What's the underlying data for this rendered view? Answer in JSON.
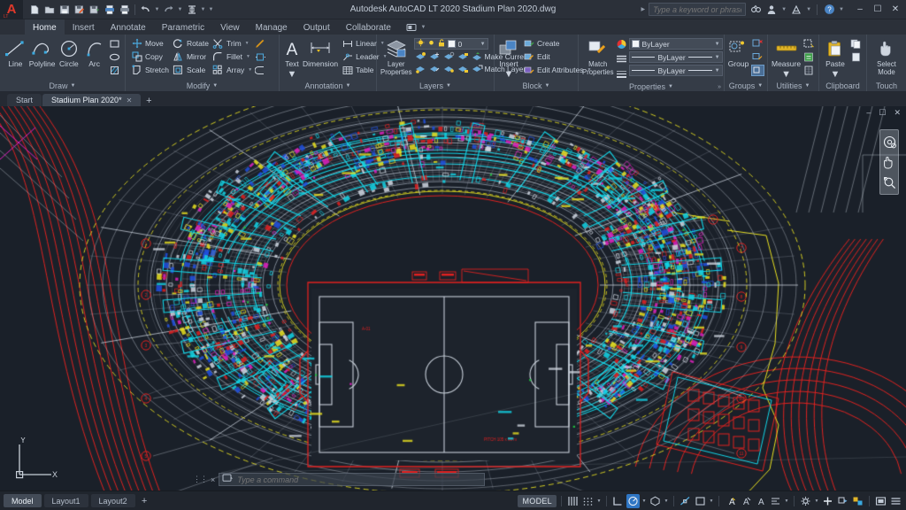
{
  "titlebar": {
    "app_logo": "autodesk-a",
    "title": "Autodesk AutoCAD LT 2020    Stadium Plan 2020.dwg",
    "search_placeholder": "Type a keyword or phrase",
    "quick_access": [
      {
        "name": "new-file",
        "icon": "page"
      },
      {
        "name": "open-file",
        "icon": "folder"
      },
      {
        "name": "save-file",
        "icon": "floppy"
      },
      {
        "name": "save-as",
        "icon": "floppy-pencil"
      },
      {
        "name": "plot-preview",
        "icon": "floppy-arrow"
      },
      {
        "name": "plot",
        "icon": "printer-blue"
      },
      {
        "name": "print",
        "icon": "printer"
      },
      {
        "name": "undo",
        "icon": "undo-arrow"
      },
      {
        "name": "redo",
        "icon": "redo-arrow"
      },
      {
        "name": "match-layer",
        "icon": "column"
      }
    ],
    "window_buttons": [
      "minimize",
      "restore",
      "close"
    ]
  },
  "ribbon_tabs": [
    {
      "label": "Home",
      "active": true
    },
    {
      "label": "Insert",
      "active": false
    },
    {
      "label": "Annotate",
      "active": false
    },
    {
      "label": "Parametric",
      "active": false
    },
    {
      "label": "View",
      "active": false
    },
    {
      "label": "Manage",
      "active": false
    },
    {
      "label": "Output",
      "active": false
    },
    {
      "label": "Collaborate",
      "active": false
    }
  ],
  "ribbon": {
    "draw": {
      "title": "Draw",
      "buttons": [
        {
          "label": "Line",
          "icon": "line-icon"
        },
        {
          "label": "Polyline",
          "icon": "polyline-icon"
        },
        {
          "label": "Circle",
          "icon": "circle-icon"
        },
        {
          "label": "Arc",
          "icon": "arc-icon"
        }
      ],
      "extras": [
        "rectangle-icon",
        "ellipse-icon",
        "hatch-icon"
      ]
    },
    "modify": {
      "title": "Modify",
      "col1": [
        {
          "label": "Move",
          "icon": "move-icon"
        },
        {
          "label": "Copy",
          "icon": "copy-icon"
        },
        {
          "label": "Stretch",
          "icon": "stretch-icon"
        }
      ],
      "col2": [
        {
          "label": "Rotate",
          "icon": "rotate-icon"
        },
        {
          "label": "Mirror",
          "icon": "mirror-icon"
        },
        {
          "label": "Scale",
          "icon": "scale-icon"
        }
      ],
      "col3": [
        {
          "label": "Trim",
          "icon": "trim-icon"
        },
        {
          "label": "Fillet",
          "icon": "fillet-icon"
        },
        {
          "label": "Array",
          "icon": "array-icon"
        }
      ],
      "extras": [
        "explode-icon",
        "offset-icon",
        "erase-icon"
      ]
    },
    "annotation": {
      "title": "Annotation",
      "buttons": [
        {
          "label": "Text",
          "icon": "text-icon"
        },
        {
          "label": "Dimension",
          "icon": "dimension-icon"
        }
      ],
      "list": [
        {
          "label": "Linear",
          "icon": "linear-dim-icon"
        },
        {
          "label": "Leader",
          "icon": "leader-icon"
        },
        {
          "label": "Table",
          "icon": "table-icon"
        }
      ]
    },
    "layers": {
      "title": "Layers",
      "big_button": {
        "label": "Layer Properties",
        "icon": "layers-icon"
      },
      "current_layer": "0",
      "actions": [
        {
          "label": "Make Current",
          "icon": "make-current-icon"
        },
        {
          "label": "Match Layer",
          "icon": "match-layer-icon"
        }
      ]
    },
    "block": {
      "title": "Block",
      "big_button": {
        "label": "Insert",
        "icon": "insert-block-icon"
      },
      "items": [
        {
          "label": "Create",
          "icon": "create-block-icon"
        },
        {
          "label": "Edit",
          "icon": "edit-block-icon"
        },
        {
          "label": "Edit Attributes",
          "icon": "edit-attributes-icon"
        }
      ]
    },
    "properties": {
      "title": "Properties",
      "big_button": {
        "label": "Match Properties",
        "icon": "match-properties-icon"
      },
      "color": "ByLayer",
      "linetype": "ByLayer",
      "lineweight": "ByLayer"
    },
    "groups": {
      "title": "Groups",
      "big_button": {
        "label": "Group",
        "icon": "group-icon"
      }
    },
    "utilities": {
      "title": "Utilities",
      "big_button": {
        "label": "Measure",
        "icon": "measure-icon"
      }
    },
    "clipboard": {
      "title": "Clipboard",
      "big_button": {
        "label": "Paste",
        "icon": "paste-icon"
      }
    },
    "touch": {
      "title": "Touch",
      "big_button": {
        "label": "Select Mode",
        "icon": "hand-pointer-icon"
      }
    }
  },
  "document_tabs": [
    {
      "label": "Start",
      "active": false,
      "closable": false
    },
    {
      "label": "Stadium Plan 2020*",
      "active": true,
      "closable": true
    }
  ],
  "document_tab_add": "+",
  "canvas": {
    "background": "#1a2029",
    "drawing_name": "stadium-plan",
    "ucs": {
      "x_label": "X",
      "y_label": "Y"
    },
    "navbar_tools": [
      "steering-wheel-icon",
      "pan-icon",
      "zoom-extents-icon"
    ],
    "window_controls": [
      "minimize",
      "restore",
      "close"
    ],
    "colors": {
      "cyan": "#12d6e8",
      "red": "#e02020",
      "yellow": "#e8e020",
      "white": "#cfd6e0",
      "blue": "#2050e0",
      "magenta": "#e020c0",
      "green": "#20c040",
      "grey": "#8d96a3"
    }
  },
  "command_line": {
    "placeholder": "Type a command",
    "close_label": "×"
  },
  "statusbar": {
    "layout_tabs": [
      {
        "label": "Model",
        "active": true
      },
      {
        "label": "Layout1",
        "active": false
      },
      {
        "label": "Layout2",
        "active": false
      }
    ],
    "layout_add": "+",
    "space_label": "MODEL",
    "toggles": [
      {
        "name": "grid-display-icon",
        "on": false
      },
      {
        "name": "snap-mode-icon",
        "on": false
      },
      {
        "name": "ortho-mode-icon",
        "on": false
      },
      {
        "name": "polar-tracking-icon",
        "on": true
      },
      {
        "name": "object-snap-icon",
        "on": false
      },
      {
        "name": "osnap-tracking-icon",
        "on": false
      },
      {
        "name": "lineweight-icon",
        "on": false
      },
      {
        "name": "transparency-icon",
        "on": false
      },
      {
        "name": "selection-cycling-icon",
        "on": true
      },
      {
        "name": "annotation-monitor-icon",
        "on": false
      },
      {
        "name": "annotation-scale-icon",
        "on": false
      },
      {
        "name": "workspace-switching-icon",
        "on": false
      },
      {
        "name": "annotation-visibility-icon",
        "on": false
      },
      {
        "name": "isolate-objects-icon",
        "on": false
      },
      {
        "name": "hardware-acceleration-icon",
        "on": false
      },
      {
        "name": "clean-screen-icon",
        "on": false
      },
      {
        "name": "customization-icon",
        "on": false
      }
    ]
  }
}
